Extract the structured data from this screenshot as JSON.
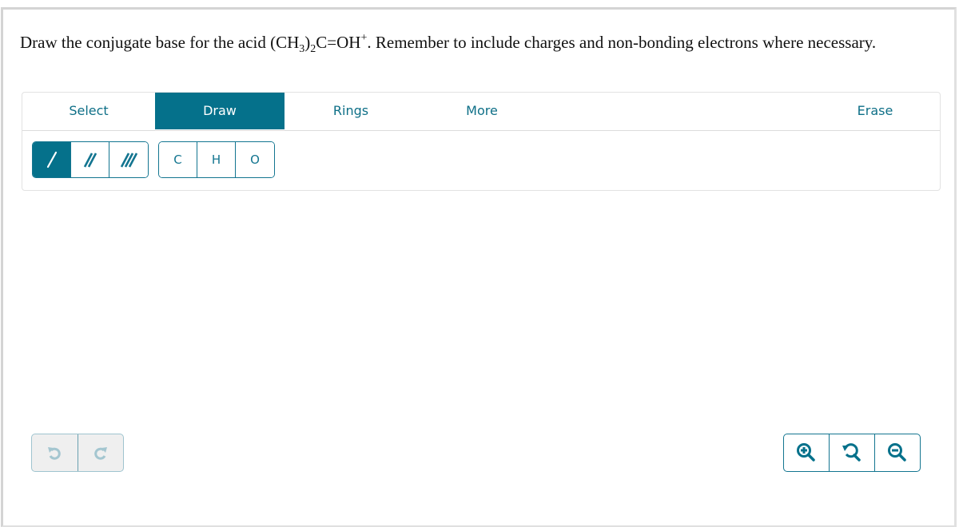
{
  "question": {
    "part1": "Draw the conjugate base for the acid (CH",
    "sub1": "3",
    "part2": ")",
    "sub2": "2",
    "part3": "C=OH",
    "sup1": "+",
    "part4": ". Remember to include charges and non-bonding electrons where necessary."
  },
  "toolbar": {
    "tabs": [
      {
        "label": "Select",
        "active": false
      },
      {
        "label": "Draw",
        "active": true
      },
      {
        "label": "Rings",
        "active": false
      },
      {
        "label": "More",
        "active": false
      },
      {
        "label": "Erase",
        "active": false
      }
    ],
    "bond_buttons": [
      {
        "icon": "single-bond-icon",
        "active": true
      },
      {
        "icon": "double-bond-icon",
        "active": false
      },
      {
        "icon": "triple-bond-icon",
        "active": false
      }
    ],
    "atom_buttons": [
      "C",
      "H",
      "O"
    ]
  },
  "history": {
    "undo_icon": "undo-icon",
    "redo_icon": "redo-icon",
    "enabled": false
  },
  "zoom_controls": {
    "zoom_in_icon": "zoom-in-icon",
    "reset_icon": "zoom-reset-icon",
    "zoom_out_icon": "zoom-out-icon"
  },
  "colors": {
    "accent": "#05718b",
    "text_accent": "#0e6f87",
    "disabled_bg": "#efefef",
    "disabled_icon": "#a4c6d0"
  }
}
